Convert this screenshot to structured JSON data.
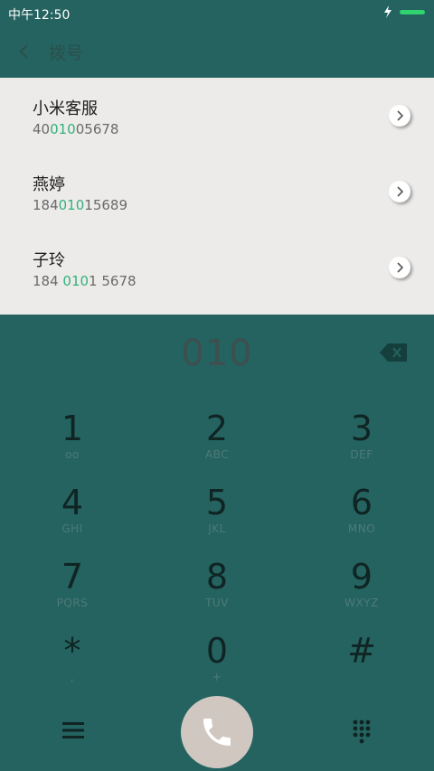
{
  "status_bar": {
    "time": "中午12:50"
  },
  "header": {
    "title": "拨号"
  },
  "results": [
    {
      "name": "小米客服",
      "number_pre": "40",
      "number_match": "010",
      "number_post": "05678"
    },
    {
      "name": "燕婷",
      "number_pre": "184",
      "number_match": "010",
      "number_post": "15689"
    },
    {
      "name": "子玲",
      "number_pre": "184 ",
      "number_match": "010",
      "number_post": "1 5678"
    }
  ],
  "dialer": {
    "input": "010",
    "keys": [
      {
        "digit": "1",
        "letters": "ᴏᴏ"
      },
      {
        "digit": "2",
        "letters": "ABC"
      },
      {
        "digit": "3",
        "letters": "DEF"
      },
      {
        "digit": "4",
        "letters": "GHI"
      },
      {
        "digit": "5",
        "letters": "JKL"
      },
      {
        "digit": "6",
        "letters": "MNO"
      },
      {
        "digit": "7",
        "letters": "PQRS"
      },
      {
        "digit": "8",
        "letters": "TUV"
      },
      {
        "digit": "9",
        "letters": "WXYZ"
      },
      {
        "digit": "*",
        "letters": ","
      },
      {
        "digit": "0",
        "letters": "+"
      },
      {
        "digit": "#",
        "letters": ""
      }
    ]
  },
  "colors": {
    "background": "#246360",
    "results_bg": "#edebe9",
    "match_highlight": "#33b07d",
    "battery": "#2fd36f"
  },
  "icons": [
    "charging-icon",
    "battery-icon",
    "back-arrow-icon",
    "chevron-right-icon",
    "backspace-icon",
    "menu-icon",
    "phone-icon",
    "keypad-icon"
  ]
}
